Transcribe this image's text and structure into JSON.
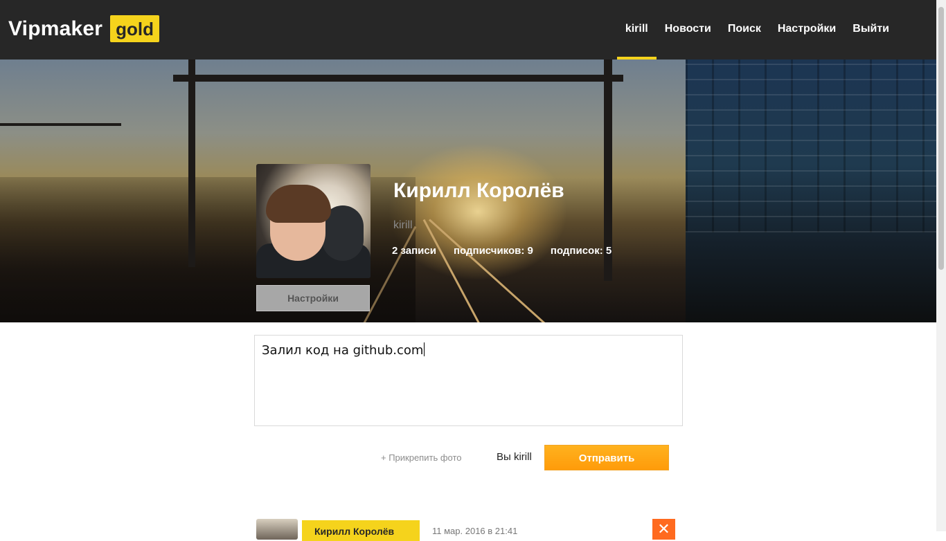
{
  "header": {
    "logo_text": "Vipmaker",
    "logo_badge": "gold",
    "nav": [
      {
        "label": "kirill",
        "active": true
      },
      {
        "label": "Новости",
        "active": false
      },
      {
        "label": "Поиск",
        "active": false
      },
      {
        "label": "Настройки",
        "active": false
      },
      {
        "label": "Выйти",
        "active": false
      }
    ]
  },
  "profile": {
    "name": "Кирилл Королёв",
    "login": "kirill",
    "settings_button": "Настройки",
    "stats": {
      "posts": "2 записи",
      "followers": "подписчиков: 9",
      "following": "подписок: 5"
    }
  },
  "composer": {
    "text": "Залил код на github.com",
    "attach_label": "+ Прикрепить фото",
    "you_label": "Вы kirill",
    "send_label": "Отправить"
  },
  "post": {
    "author": "Кирилл Королёв",
    "date": "11 мар. 2016 в 21:41",
    "close_symbol": "✕"
  },
  "colors": {
    "topbar": "#272727",
    "accent_yellow": "#f5d31c",
    "send_orange": "#ff9b0a",
    "close_orange": "#ff6a1f"
  }
}
